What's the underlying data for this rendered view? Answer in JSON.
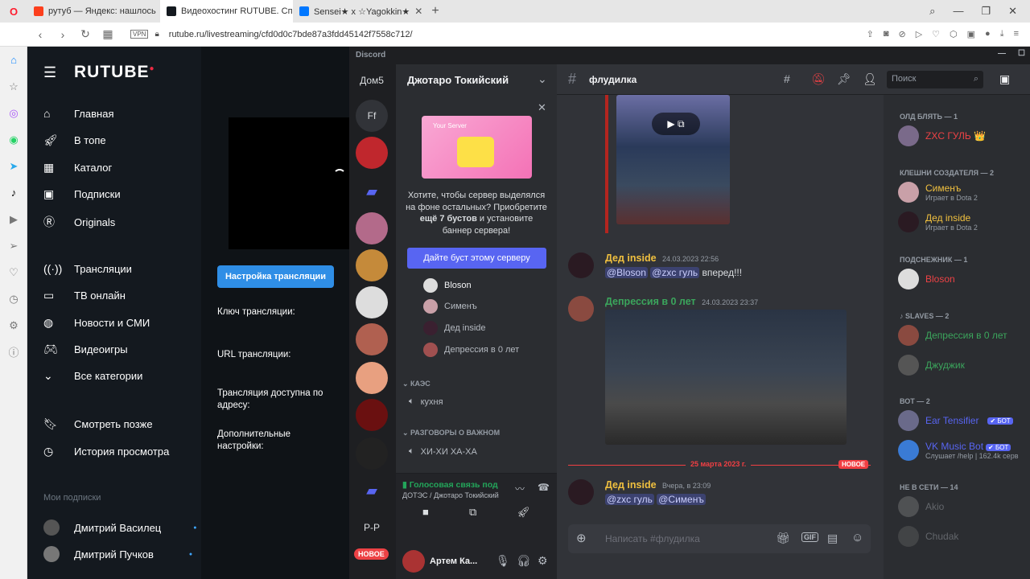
{
  "browser": {
    "tabs": [
      {
        "title": "рутуб — Яндекс: нашлось",
        "color": "#fc3f1d"
      },
      {
        "title": "Видеохостинг RUTUBE. Сп",
        "color": "#14191f"
      },
      {
        "title": "Sensei★ x ☆Yagokkin★",
        "color": "#0077ff"
      }
    ],
    "new_tab": "+",
    "vpn": "VPN",
    "url": "rutube.ru/livestreaming/cfd0d0c7bde87a3fdd45142f7558c712/"
  },
  "rutube": {
    "logo": "RUTUBE",
    "nav": [
      "Главная",
      "В топе",
      "Каталог",
      "Подписки",
      "Originals"
    ],
    "nav2": [
      "Трансляции",
      "ТВ онлайн",
      "Новости и СМИ",
      "Видеоигры",
      "Все категории"
    ],
    "nav3": [
      "Смотреть позже",
      "История просмотра"
    ],
    "subs_header": "Мои подписки",
    "subs": [
      "Дмитрий Василец",
      "Дмитрий Пучков"
    ],
    "stream_button": "Настройка трансляции",
    "fields": [
      "Ключ трансляции:",
      "URL трансляции:",
      "Трансляция доступна по адресу:",
      "Дополнительные настройки:"
    ]
  },
  "discord": {
    "app_title": "Discord",
    "servers": [
      "Дом5",
      "Ff",
      "P-P"
    ],
    "new_badge": "НОВОЕ",
    "server_name": "Джотаро Токийский",
    "boost": {
      "card": "Your Server",
      "text1": "Хотите, чтобы сервер выделялся на фоне остальных? Приобретите ",
      "text_bold": "ещё 7 бустов",
      "text2": " и установите баннер сервера!",
      "button": "Дайте буст этому серверу"
    },
    "voice_users": [
      "Bloson",
      "Сименъ",
      "Дед inside",
      "Депрессия в 0 лет"
    ],
    "categories": [
      {
        "name": "КАЭС",
        "channel": "кухня"
      },
      {
        "name": "РАЗГОВОРЫ О ВАЖНОМ",
        "channel": "ХИ-ХИ ХА-ХА"
      }
    ],
    "voice_status": "Голосовая связь под",
    "voice_location": "ДОТЭС / Джотаро Токийский",
    "user": "Артем Ка...",
    "channel": "флудилка",
    "search_placeholder": "Поиск",
    "messages": [
      {
        "author": "Дед inside",
        "time": "24.03.2023 22:56",
        "mentions": [
          "@Bloson",
          "@zxc гуль"
        ],
        "text": "вперед!!!",
        "color": "#f0c03f"
      },
      {
        "author": "Депрессия в 0 лет",
        "time": "24.03.2023 23:37",
        "color": "#3ba55c"
      },
      {
        "author": "Дед inside",
        "time": "Вчера, в 23:09",
        "mentions": [
          "@zxc гуль",
          "@Сименъ"
        ],
        "color": "#f0c03f"
      }
    ],
    "divider_date": "25 марта 2023 г.",
    "divider_badge": "НОВОЕ",
    "input_placeholder": "Написать #флудилка",
    "gif": "GIF",
    "member_groups": [
      {
        "header": "ОЛД БЛЯТЬ — 1",
        "members": [
          {
            "name": "ZXC ГУЛЬ 👑",
            "color": "#ed4245"
          }
        ]
      },
      {
        "header": "КЛЕШНИ СОЗДАТЕЛЯ — 2",
        "members": [
          {
            "name": "Сименъ",
            "sub": "Играет в Dota 2",
            "color": "#f0c03f"
          },
          {
            "name": "Дед inside",
            "sub": "Играет в Dota 2",
            "color": "#f0c03f"
          }
        ]
      },
      {
        "header": "ПОДСНЕЖНИК — 1",
        "members": [
          {
            "name": "Bloson",
            "color": "#ed4245"
          }
        ]
      },
      {
        "header": "SLAVES — 2",
        "members": [
          {
            "name": "Депрессия в 0 лет",
            "color": "#3ba55c"
          },
          {
            "name": "Джуджик",
            "color": "#3ba55c"
          }
        ]
      },
      {
        "header": "ВОТ — 2",
        "members": [
          {
            "name": "Ear Tensifier",
            "color": "#5865f2",
            "bot": "✔ БОТ"
          },
          {
            "name": "VK Music Bot",
            "sub": "Слушает /help | 162.4k серв",
            "color": "#5865f2",
            "bot": "✔ БОТ"
          }
        ]
      },
      {
        "header": "НЕ В СЕТИ — 14",
        "members": [
          {
            "name": "Akio",
            "color": "#6d6f78"
          },
          {
            "name": "Chudak",
            "color": "#6d6f78"
          }
        ]
      }
    ]
  }
}
